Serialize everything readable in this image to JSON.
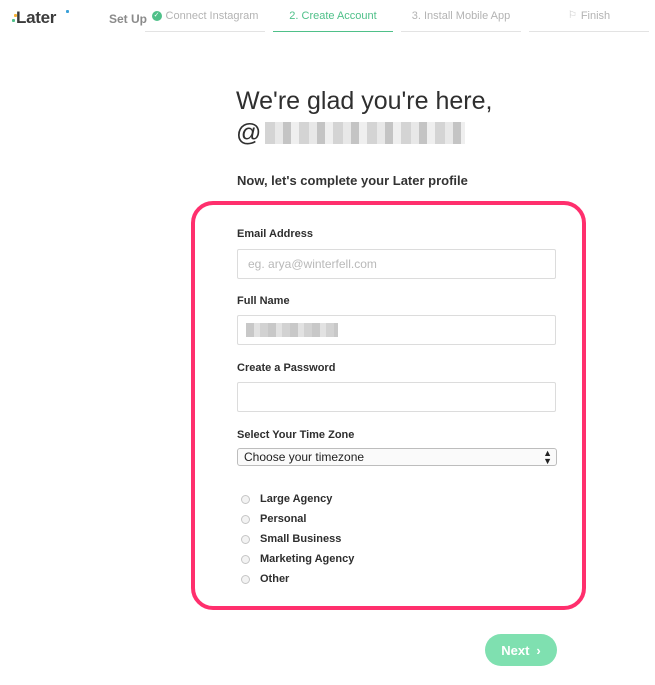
{
  "brand": {
    "logo": "Later",
    "colors": {
      "accent": "#4fc089",
      "highlight": "#ff2f6d",
      "button": "#7fe0b0"
    }
  },
  "header": {
    "setup_label": "Set Up",
    "steps": [
      {
        "label": "Connect Instagram",
        "icon": "check-circle-icon",
        "state": "done"
      },
      {
        "label": "2. Create Account",
        "state": "active"
      },
      {
        "label": "3. Install Mobile App",
        "state": "upcoming"
      },
      {
        "label": "Finish",
        "icon": "flag-icon",
        "state": "upcoming"
      }
    ]
  },
  "main": {
    "heading": "We're glad you're here,",
    "handle_prefix": "@",
    "subheading": "Now, let's complete your Later profile"
  },
  "form": {
    "email_label": "Email Address",
    "email_placeholder": "eg. arya@winterfell.com",
    "email_value": "",
    "fullname_label": "Full Name",
    "password_label": "Create a Password",
    "password_value": "",
    "timezone_label": "Select Your Time Zone",
    "timezone_selected": "Choose your timezone",
    "account_types": [
      "Large Agency",
      "Personal",
      "Small Business",
      "Marketing Agency",
      "Other"
    ]
  },
  "actions": {
    "next_label": "Next"
  }
}
